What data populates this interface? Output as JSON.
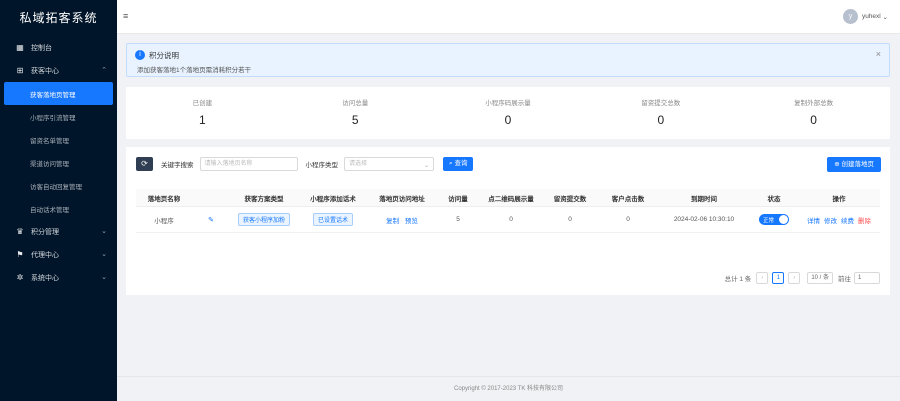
{
  "sidebar": {
    "logo": "私域拓客系统",
    "items": [
      {
        "label": "控制台",
        "icon": "dashboard-icon"
      },
      {
        "label": "获客中心",
        "icon": "acquisition-icon",
        "expanded": true
      },
      {
        "label": "积分管理",
        "icon": "points-icon"
      },
      {
        "label": "代理中心",
        "icon": "agent-icon"
      },
      {
        "label": "系统中心",
        "icon": "system-icon"
      }
    ],
    "sub_items": [
      {
        "label": "获客落地页管理",
        "active": true
      },
      {
        "label": "小程序引流管理"
      },
      {
        "label": "留资名单管理"
      },
      {
        "label": "渠道访问管理"
      },
      {
        "label": "访客自动回复管理"
      },
      {
        "label": "自动话术管理"
      }
    ]
  },
  "header": {
    "menu_icon": "≡",
    "user_initial": "y",
    "user_name": "yuhexl"
  },
  "alert": {
    "title": "积分说明",
    "desc": "添加获客落地1个落地页需消耗积分若干"
  },
  "stats": [
    {
      "label": "已创建",
      "value": "1"
    },
    {
      "label": "访问总量",
      "value": "5"
    },
    {
      "label": "小程序码展示量",
      "value": "0"
    },
    {
      "label": "留资提交总数",
      "value": "0"
    },
    {
      "label": "复制外部总数",
      "value": "0"
    }
  ],
  "toolbar": {
    "keyword_label": "关键字搜索",
    "keyword_placeholder": "请输入落地页名称",
    "type_label": "小程序类型",
    "type_placeholder": "请选择",
    "search_label": "查询",
    "create_label": "创建落地页"
  },
  "table": {
    "headers": [
      "落地页名称",
      "",
      "获客方案类型",
      "小程序添加话术",
      "落地页访问地址",
      "访问量",
      "点二维码展示量",
      "留资提交数",
      "客户点击数",
      "到期时间",
      "状态",
      "操作"
    ],
    "rows": [
      {
        "name": "小程序",
        "scheme_type": "获客小程序加粉",
        "script_tag": "已设置话术",
        "link_copy": "复制",
        "link_preview": "预览",
        "visits": "5",
        "qr_views": "0",
        "leads": "0",
        "clicks": "0",
        "expire": "2024-02-06 10:30:10",
        "status": "正常",
        "actions": [
          "详情",
          "修改",
          "续费",
          "删除"
        ]
      }
    ]
  },
  "pager": {
    "total": "总计 1 条",
    "prev": "‹",
    "page": "1",
    "next": "›",
    "size": "10 / 条",
    "jump_label": "前往",
    "jump_value": "1"
  },
  "footer": {
    "text": "Copyright © 2017-2023 TK 科技有限公司"
  }
}
